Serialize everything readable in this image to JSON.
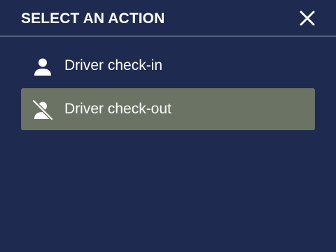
{
  "dialog": {
    "title": "SELECT AN ACTION",
    "close_icon": "close-icon"
  },
  "menu": {
    "items": [
      {
        "label": "Driver check-in",
        "icon": "person-icon",
        "selected": false
      },
      {
        "label": "Driver check-out",
        "icon": "person-off-icon",
        "selected": true
      }
    ]
  },
  "colors": {
    "background": "#1e2a4f",
    "selected_row": "#6b7365",
    "text": "#ffffff",
    "divider": "#b7bccb"
  }
}
